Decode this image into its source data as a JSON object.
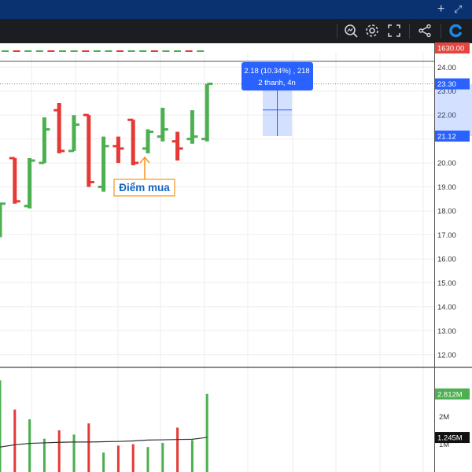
{
  "window": {
    "add_icon": "plus-icon",
    "expand_icon": "expand-icon"
  },
  "toolbar": {
    "icons": [
      "search-chart-icon",
      "gear-icon",
      "fullscreen-icon",
      "share-icon",
      "brand-logo-icon"
    ]
  },
  "top_strip": {
    "price_label": "1630.00",
    "price_label_color": "#e2463e"
  },
  "measure": {
    "line1": "2.18 (10.34%) , 218",
    "line2": "2 thanh, 4n",
    "box_color": "#2962ff"
  },
  "annotation": {
    "label": "Điểm mua",
    "color": "#f7931a"
  },
  "chart_data": {
    "type": "bar",
    "subtype": "ohlc",
    "colors": {
      "up": "#4caf50",
      "down": "#e53935",
      "grid": "#eeeeee",
      "volume_ma": "#333333"
    },
    "price_axis": {
      "ylim": [
        11.5,
        24.6
      ],
      "ticks": [
        "24.00",
        "23.00",
        "22.00",
        "21.00",
        "20.00",
        "19.00",
        "18.00",
        "17.00",
        "16.00",
        "15.00",
        "14.00",
        "13.00",
        "12.00"
      ],
      "tick_values": [
        24,
        23,
        22,
        21,
        20,
        19,
        18,
        17,
        16,
        15,
        14,
        13,
        12
      ],
      "current_price_label": "23.30",
      "current_price": 23.3,
      "measure_low_label": "21.12",
      "measure_low": 21.12
    },
    "bars": [
      {
        "o": 16.9,
        "h": 18.3,
        "l": 16.9,
        "c": 18.3
      },
      {
        "o": 20.2,
        "h": 20.2,
        "l": 18.3,
        "c": 18.4
      },
      {
        "o": 18.2,
        "h": 20.2,
        "l": 18.1,
        "c": 20.1
      },
      {
        "o": 20.0,
        "h": 21.9,
        "l": 20.0,
        "c": 21.4
      },
      {
        "o": 22.2,
        "h": 22.5,
        "l": 20.4,
        "c": 20.5
      },
      {
        "o": 20.5,
        "h": 22.0,
        "l": 20.5,
        "c": 21.6
      },
      {
        "o": 22.0,
        "h": 22.0,
        "l": 19.0,
        "c": 19.2
      },
      {
        "o": 19.0,
        "h": 21.1,
        "l": 18.8,
        "c": 20.7
      },
      {
        "o": 20.7,
        "h": 21.1,
        "l": 20.0,
        "c": 20.6
      },
      {
        "o": 21.8,
        "h": 21.8,
        "l": 19.9,
        "c": 20.0
      },
      {
        "o": 20.6,
        "h": 21.4,
        "l": 20.4,
        "c": 21.3
      },
      {
        "o": 21.1,
        "h": 22.3,
        "l": 20.9,
        "c": 21.4
      },
      {
        "o": 20.9,
        "h": 21.3,
        "l": 20.1,
        "c": 20.6
      },
      {
        "o": 21.0,
        "h": 22.2,
        "l": 20.8,
        "c": 21.1
      },
      {
        "o": 21.0,
        "h": 23.3,
        "l": 20.9,
        "c": 23.3
      }
    ],
    "volume_axis": {
      "ymax": 3.4,
      "ticks": [
        "2M",
        "1M"
      ],
      "tick_values": [
        2,
        1
      ],
      "current_volume_label": "2.812M",
      "current_volume": 2.812,
      "ma_label": "1.245M",
      "ma_value": 1.245
    },
    "volumes": [
      3.3,
      2.25,
      1.9,
      1.2,
      1.5,
      1.35,
      1.75,
      0.7,
      0.95,
      1.0,
      0.9,
      1.05,
      1.6,
      1.15,
      2.812
    ],
    "volume_ma": [
      0.9,
      0.98,
      1.03,
      1.05,
      1.07,
      1.08,
      1.08,
      1.09,
      1.1,
      1.12,
      1.15,
      1.16,
      1.17,
      1.18,
      1.245
    ]
  }
}
